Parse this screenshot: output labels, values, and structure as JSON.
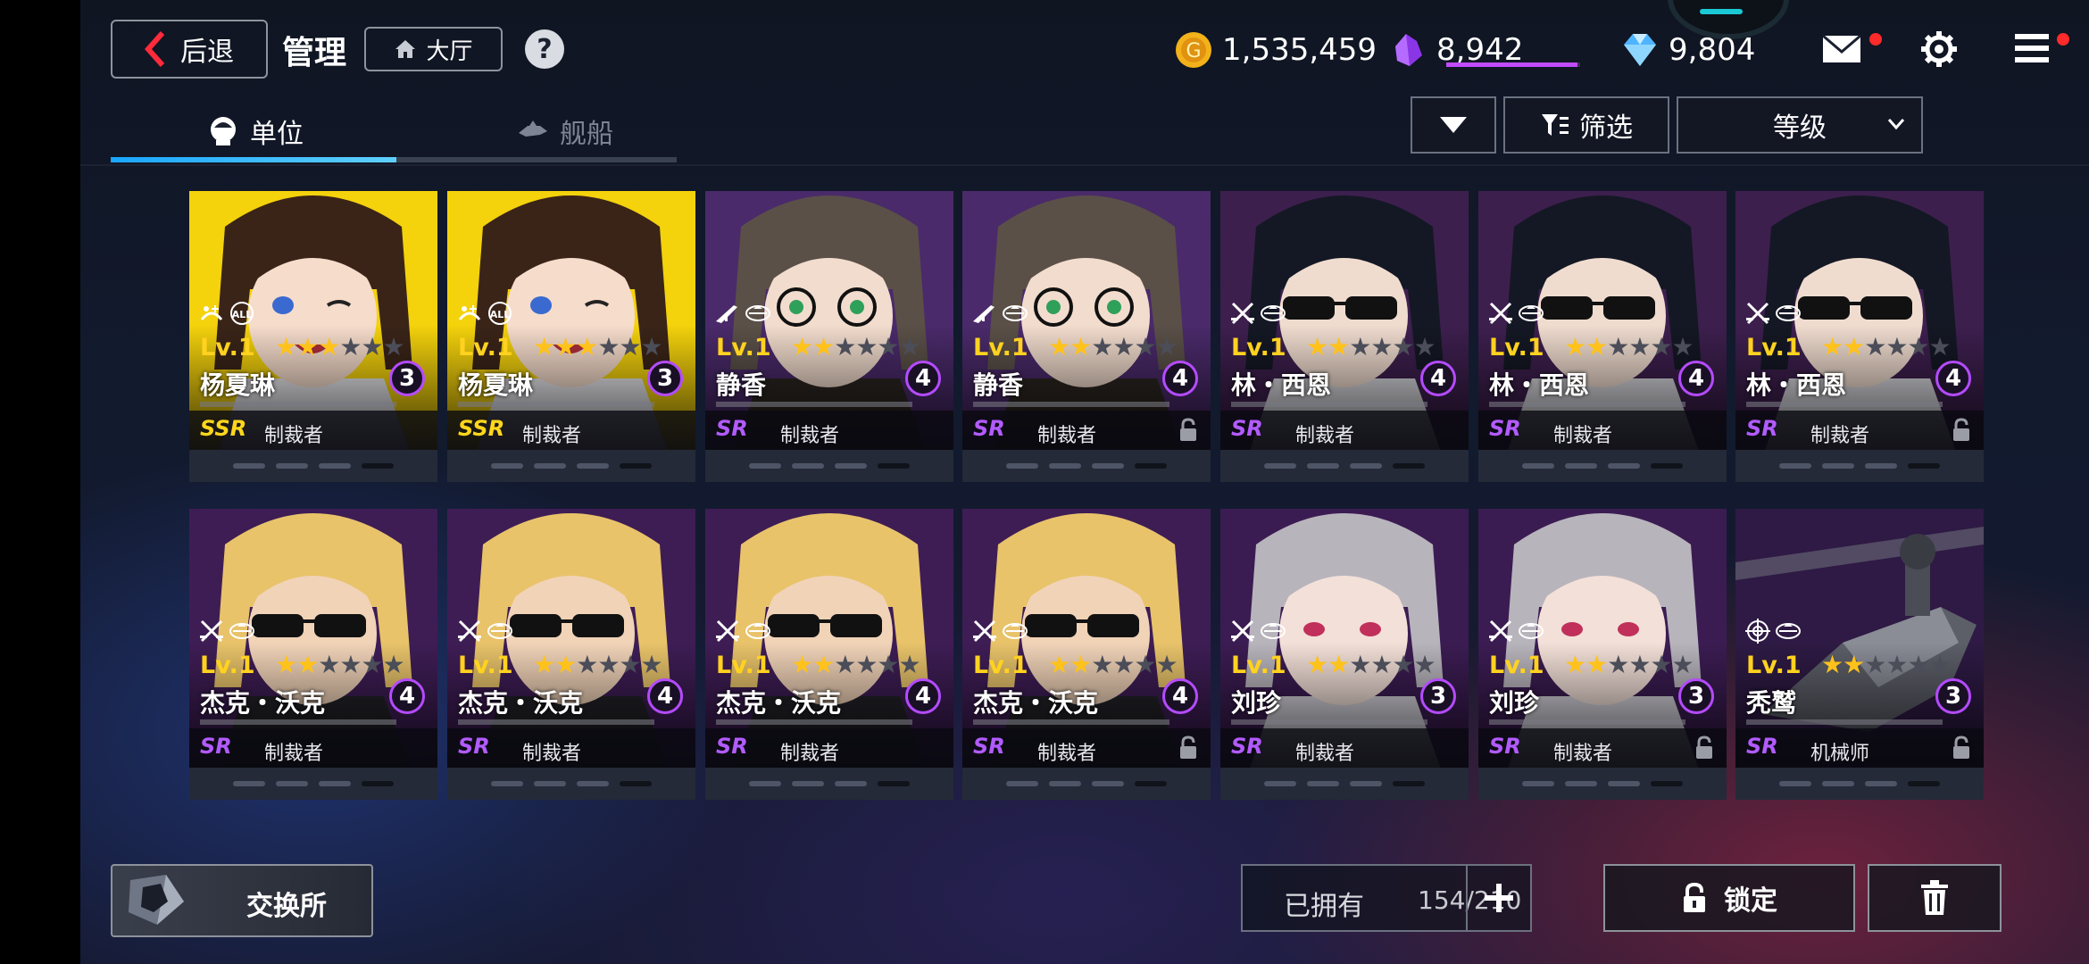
{
  "header": {
    "back_label": "后退",
    "title": "管理",
    "lobby_label": "大厅",
    "help_label": "?",
    "gold": "1,535,459",
    "crystal": "8,942",
    "crystal_progress": 0.98,
    "gem": "9,804"
  },
  "tabs": [
    {
      "label": "单位",
      "active": true
    },
    {
      "label": "舰船",
      "active": false
    }
  ],
  "controls": {
    "filter_label": "筛选",
    "sort_label": "等级"
  },
  "units": [
    {
      "name": "杨夏琳",
      "level": "Lv.1",
      "stars": 3,
      "max_stars": 6,
      "rarity": "SSR",
      "class": "制裁者",
      "limit": "3",
      "locked": false,
      "roles": [
        "support-icon",
        "all-target-icon"
      ]
    },
    {
      "name": "杨夏琳",
      "level": "Lv.1",
      "stars": 3,
      "max_stars": 6,
      "rarity": "SSR",
      "class": "制裁者",
      "limit": "3",
      "locked": false,
      "roles": [
        "support-icon",
        "all-target-icon"
      ]
    },
    {
      "name": "静香",
      "level": "Lv.1",
      "stars": 2,
      "max_stars": 6,
      "rarity": "SR",
      "class": "制裁者",
      "limit": "4",
      "locked": false,
      "roles": [
        "rifle-icon",
        "ground-icon"
      ]
    },
    {
      "name": "静香",
      "level": "Lv.1",
      "stars": 2,
      "max_stars": 6,
      "rarity": "SR",
      "class": "制裁者",
      "limit": "4",
      "locked": true,
      "roles": [
        "rifle-icon",
        "ground-icon"
      ]
    },
    {
      "name": "林・西恩",
      "level": "Lv.1",
      "stars": 2,
      "max_stars": 6,
      "rarity": "SR",
      "class": "制裁者",
      "limit": "4",
      "locked": false,
      "roles": [
        "crossed-swords-icon",
        "ground-icon"
      ]
    },
    {
      "name": "林・西恩",
      "level": "Lv.1",
      "stars": 2,
      "max_stars": 6,
      "rarity": "SR",
      "class": "制裁者",
      "limit": "4",
      "locked": false,
      "roles": [
        "crossed-swords-icon",
        "ground-icon"
      ]
    },
    {
      "name": "林・西恩",
      "level": "Lv.1",
      "stars": 2,
      "max_stars": 6,
      "rarity": "SR",
      "class": "制裁者",
      "limit": "4",
      "locked": true,
      "roles": [
        "crossed-swords-icon",
        "ground-icon"
      ]
    },
    {
      "name": "杰克・沃克",
      "level": "Lv.1",
      "stars": 2,
      "max_stars": 6,
      "rarity": "SR",
      "class": "制裁者",
      "limit": "4",
      "locked": false,
      "roles": [
        "crossed-swords-icon",
        "ground-icon"
      ]
    },
    {
      "name": "杰克・沃克",
      "level": "Lv.1",
      "stars": 2,
      "max_stars": 6,
      "rarity": "SR",
      "class": "制裁者",
      "limit": "4",
      "locked": false,
      "roles": [
        "crossed-swords-icon",
        "ground-icon"
      ]
    },
    {
      "name": "杰克・沃克",
      "level": "Lv.1",
      "stars": 2,
      "max_stars": 6,
      "rarity": "SR",
      "class": "制裁者",
      "limit": "4",
      "locked": false,
      "roles": [
        "crossed-swords-icon",
        "ground-icon"
      ]
    },
    {
      "name": "杰克・沃克",
      "level": "Lv.1",
      "stars": 2,
      "max_stars": 6,
      "rarity": "SR",
      "class": "制裁者",
      "limit": "4",
      "locked": true,
      "roles": [
        "crossed-swords-icon",
        "ground-icon"
      ]
    },
    {
      "name": "刘珍",
      "level": "Lv.1",
      "stars": 2,
      "max_stars": 6,
      "rarity": "SR",
      "class": "制裁者",
      "limit": "3",
      "locked": false,
      "roles": [
        "crossed-swords-icon",
        "ground-icon"
      ]
    },
    {
      "name": "刘珍",
      "level": "Lv.1",
      "stars": 2,
      "max_stars": 6,
      "rarity": "SR",
      "class": "制裁者",
      "limit": "3",
      "locked": true,
      "roles": [
        "crossed-swords-icon",
        "ground-icon"
      ]
    },
    {
      "name": "秃鹫",
      "level": "Lv.1",
      "stars": 2,
      "max_stars": 6,
      "rarity": "SR",
      "class": "机械师",
      "limit": "3",
      "locked": true,
      "roles": [
        "target-icon",
        "ground-icon"
      ]
    }
  ],
  "footer": {
    "exchange_label": "交换所",
    "owned_label": "已拥有",
    "owned_value": "154/210",
    "lock_label": "锁定"
  }
}
